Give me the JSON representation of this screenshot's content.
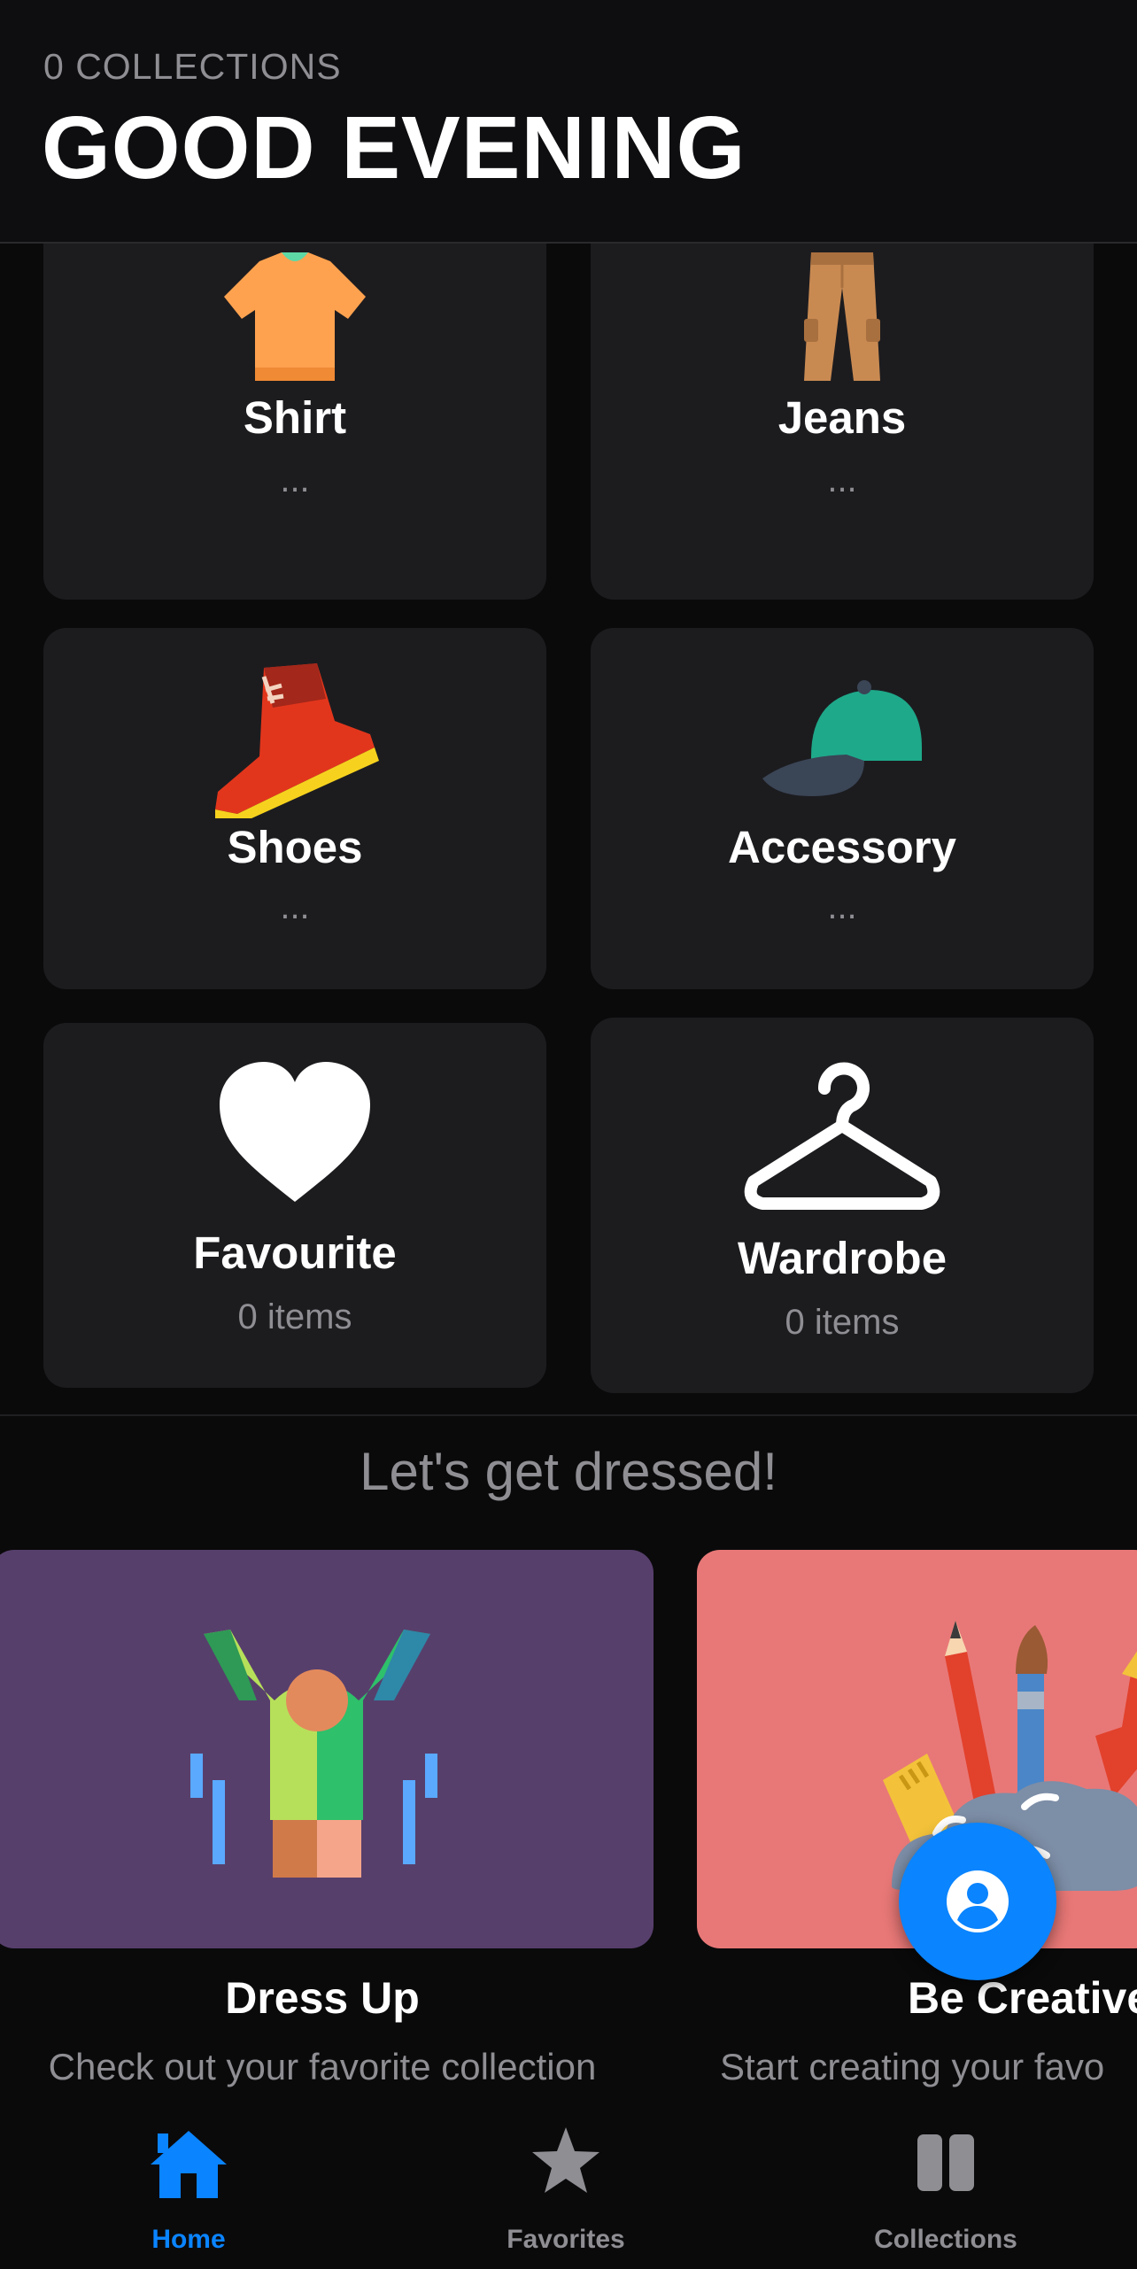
{
  "header": {
    "subtitle": "0 COLLECTIONS",
    "title": "GOOD EVENING"
  },
  "categories": [
    {
      "label": "Shirt",
      "sub": "...",
      "icon": "shirt-icon"
    },
    {
      "label": "Jeans",
      "sub": "...",
      "icon": "pants-icon"
    },
    {
      "label": "Shoes",
      "sub": "...",
      "icon": "sneaker-icon"
    },
    {
      "label": "Accessory",
      "sub": "...",
      "icon": "cap-icon"
    },
    {
      "label": "Favourite",
      "sub": "0 items",
      "icon": "heart-icon"
    },
    {
      "label": "Wardrobe",
      "sub": "0 items",
      "icon": "hanger-icon"
    }
  ],
  "section": {
    "title": "Let's get dressed!"
  },
  "promos": [
    {
      "title": "Dress Up",
      "desc": "Check out your favorite collection",
      "bg": "#573f6c",
      "icon": "dress-up-illustration"
    },
    {
      "title": "Be Creative",
      "desc": "Start creating your favo",
      "bg": "#e87877",
      "icon": "art-supplies-illustration"
    }
  ],
  "fab": {
    "icon": "profile-icon",
    "color": "#0a84ff"
  },
  "tabbar": {
    "items": [
      {
        "label": "Home",
        "icon": "home-icon",
        "active": true
      },
      {
        "label": "Favorites",
        "icon": "star-icon",
        "active": false
      },
      {
        "label": "Collections",
        "icon": "collections-icon",
        "active": false
      }
    ],
    "active_color": "#0a84ff",
    "inactive_color": "#8e8e93"
  }
}
